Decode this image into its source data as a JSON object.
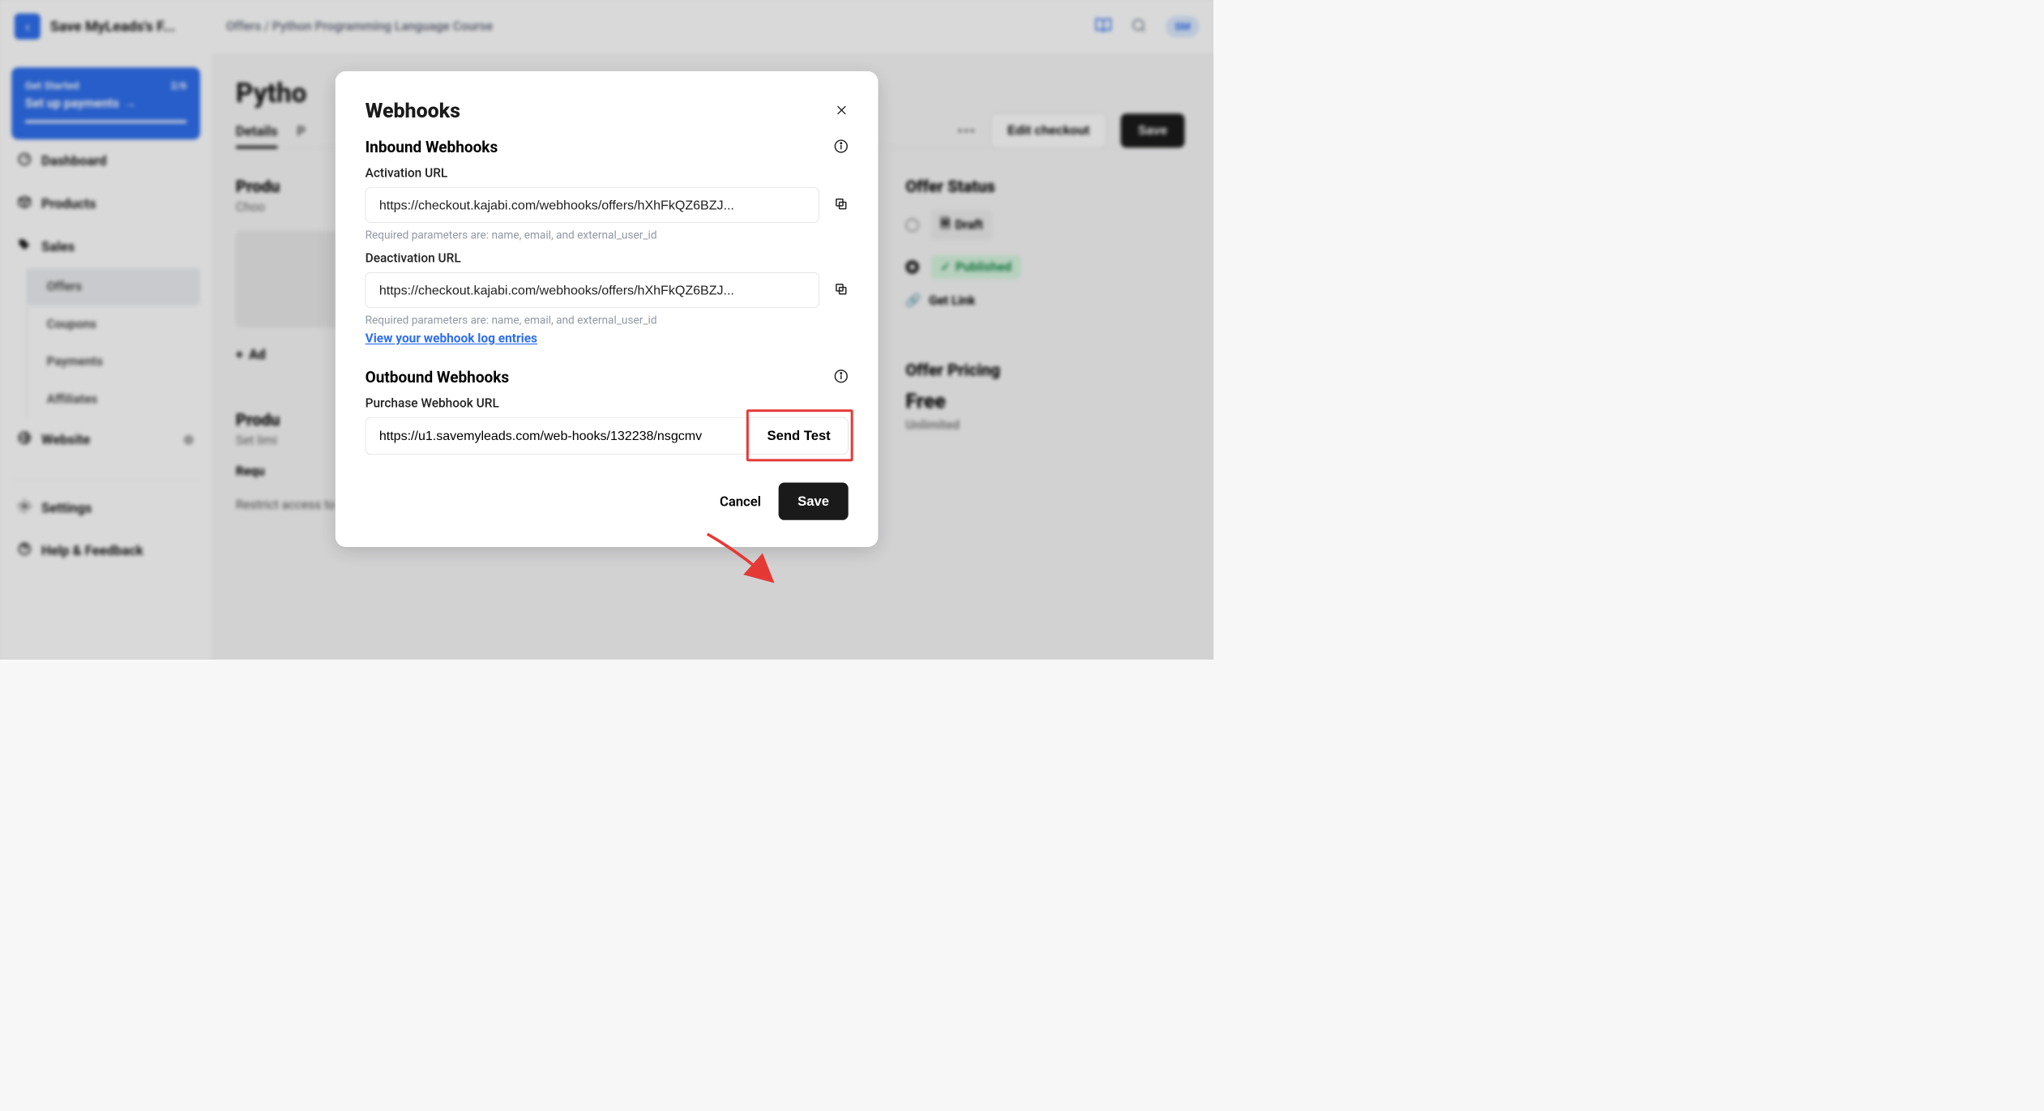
{
  "topbar": {
    "logo_char": "‹",
    "site_title": "Save MyLeads's F...",
    "breadcrumb_a": "Offers",
    "breadcrumb_sep": "/",
    "breadcrumb_b": "Python Programming Language Course",
    "avatar": "SM"
  },
  "sidebar": {
    "gs_label": "Get Started",
    "gs_count": "2/6",
    "gs_step": "Set up payments",
    "dashboard": "Dashboard",
    "products": "Products",
    "sales": "Sales",
    "offers": "Offers",
    "coupons": "Coupons",
    "payments": "Payments",
    "affiliates": "Affiliates",
    "website": "Website",
    "settings": "Settings",
    "help": "Help & Feedback"
  },
  "content": {
    "page_title": "Pytho",
    "tab_details": "Details",
    "tab_pricing": "P",
    "products_heading": "Produ",
    "products_sub": "Choo",
    "add_another": "Ad",
    "access_heading": "Produ",
    "access_sub": "Set limi",
    "req_label": "Requ",
    "restrict_text": "Restrict access to a specific amount of days",
    "edit_checkout": "Edit checkout",
    "save": "Save",
    "status_heading": "Offer Status",
    "draft": "Draft",
    "published": "Published",
    "get_link": "Get Link",
    "pricing_heading": "Offer Pricing",
    "free": "Free",
    "unlimited": "Unlimited"
  },
  "modal": {
    "title": "Webhooks",
    "inbound_title": "Inbound Webhooks",
    "activation_label": "Activation URL",
    "activation_value": "https://checkout.kajabi.com/webhooks/offers/hXhFkQZ6BZJ...",
    "activation_hint": "Required parameters are: name, email, and external_user_id",
    "deactivation_label": "Deactivation URL",
    "deactivation_value": "https://checkout.kajabi.com/webhooks/offers/hXhFkQZ6BZJ...",
    "deactivation_hint": "Required parameters are: name, email, and external_user_id",
    "log_link": "View your webhook log entries",
    "outbound_title": "Outbound Webhooks",
    "purchase_label": "Purchase Webhook URL",
    "purchase_value": "https://u1.savemyleads.com/web-hooks/132238/nsgcmv",
    "send_test": "Send Test",
    "cancel": "Cancel",
    "save": "Save"
  }
}
